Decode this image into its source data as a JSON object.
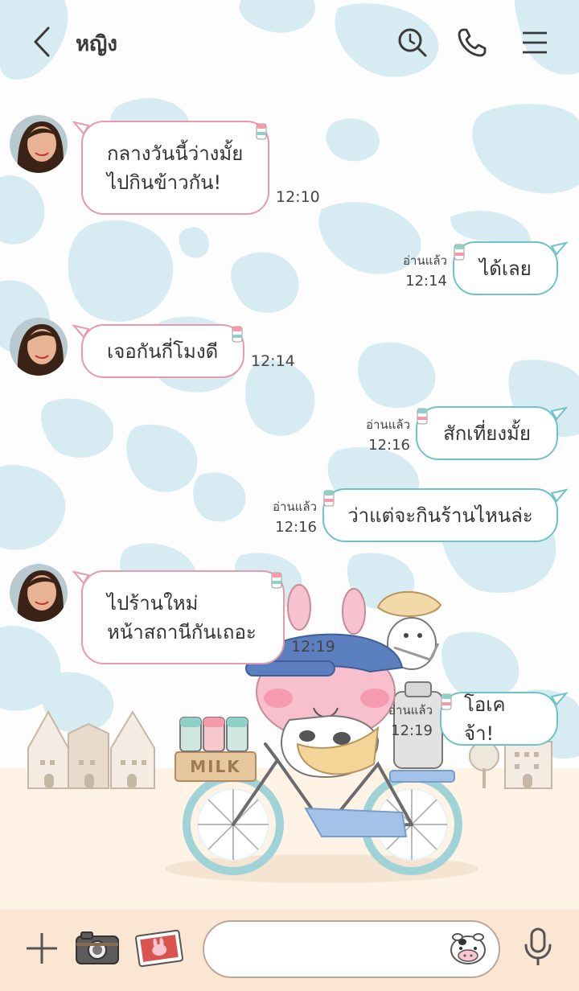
{
  "header": {
    "contact_name": "หญิง",
    "icons": [
      "back-icon",
      "history-search-icon",
      "phone-icon",
      "menu-icon"
    ]
  },
  "messages": [
    {
      "direction": "incoming",
      "text": "กลางวันนี้ว่างมั้ย\nไปกินข้าวกัน!",
      "time": "12:10"
    },
    {
      "direction": "outgoing",
      "text": "ได้เลย",
      "status": "อ่านแล้ว",
      "time": "12:14"
    },
    {
      "direction": "incoming",
      "text": "เจอกันกี่โมงดี",
      "time": "12:14"
    },
    {
      "direction": "outgoing",
      "text": "สักเที่ยงมั้ย",
      "status": "อ่านแล้ว",
      "time": "12:16"
    },
    {
      "direction": "outgoing",
      "text": "ว่าแต่จะกินร้านไหนล่ะ",
      "status": "อ่านแล้ว",
      "time": "12:16"
    },
    {
      "direction": "incoming",
      "text": "ไปร้านใหม่\nหน้าสถานีกันเถอะ",
      "time": "12:19"
    },
    {
      "direction": "outgoing",
      "text": "โอเคจ้า!",
      "status": "อ่านแล้ว",
      "time": "12:19"
    }
  ],
  "illustration": {
    "crate_label": "MILK"
  },
  "input_bar": {
    "placeholder": "",
    "icons": [
      "plus-icon",
      "camera-icon",
      "image-icon",
      "emoji-icon",
      "mic-icon"
    ]
  },
  "colors": {
    "incoming_border": "#e79aa9",
    "outgoing_border": "#6fc3c8",
    "background_spots": "#d7ecf2",
    "input_bar_bg": "#fbe6d3"
  }
}
